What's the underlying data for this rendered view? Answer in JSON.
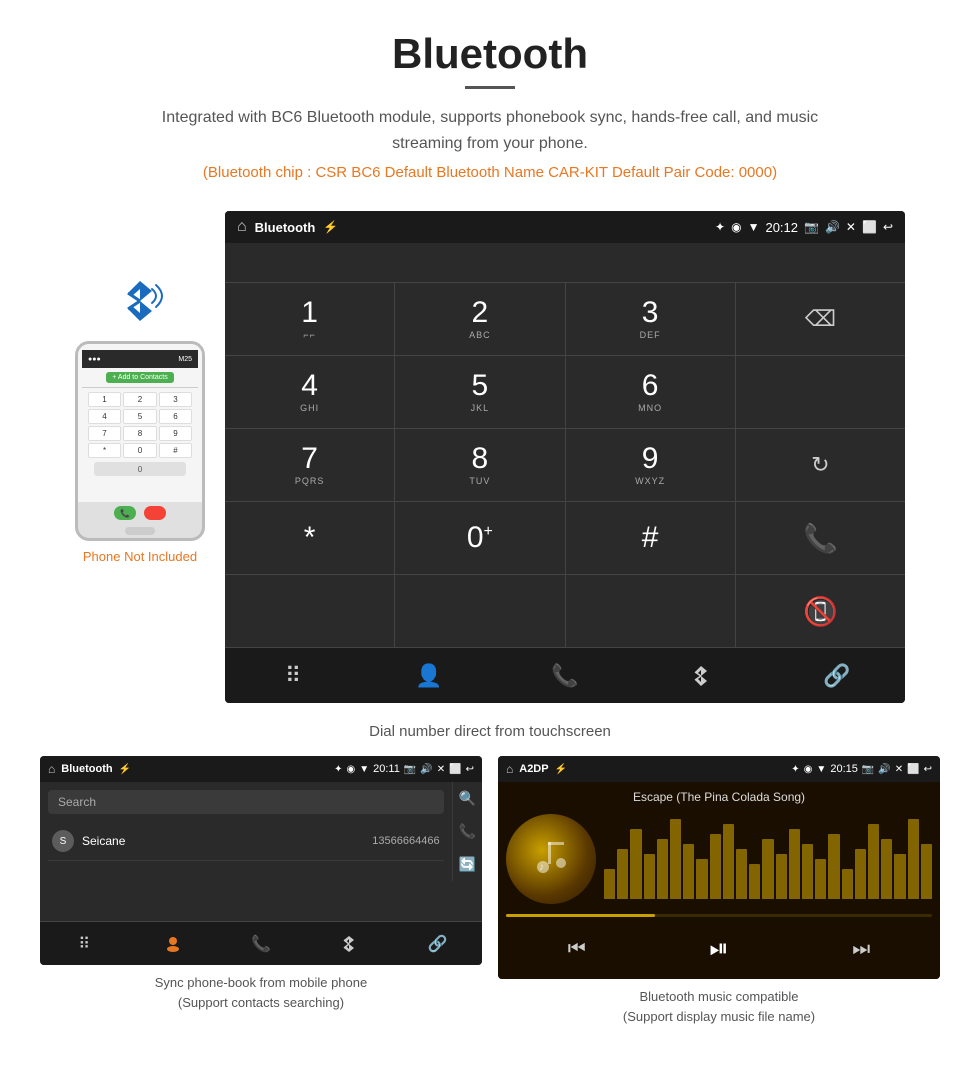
{
  "header": {
    "title": "Bluetooth",
    "description": "Integrated with BC6 Bluetooth module, supports phonebook sync, hands-free call, and music streaming from your phone.",
    "specs": "(Bluetooth chip : CSR BC6    Default Bluetooth Name CAR-KIT    Default Pair Code: 0000)"
  },
  "dial_screen": {
    "status_bar": {
      "app_name": "Bluetooth",
      "time": "20:12",
      "usb_icon": "⚡",
      "bt_icon": "✦",
      "location_icon": "◉",
      "signal_icon": "▼",
      "camera_icon": "⬛",
      "volume_icon": "🔊",
      "close_icon": "✕",
      "window_icon": "⬜",
      "back_icon": "↩"
    },
    "keys": [
      {
        "main": "1",
        "sub": "⌐⌐"
      },
      {
        "main": "2",
        "sub": "ABC"
      },
      {
        "main": "3",
        "sub": "DEF"
      },
      {
        "main": "",
        "sub": "",
        "special": "delete"
      },
      {
        "main": "4",
        "sub": "GHI"
      },
      {
        "main": "5",
        "sub": "JKL"
      },
      {
        "main": "6",
        "sub": "MNO"
      },
      {
        "main": "",
        "sub": "",
        "special": "empty"
      },
      {
        "main": "7",
        "sub": "PQRS"
      },
      {
        "main": "8",
        "sub": "TUV"
      },
      {
        "main": "9",
        "sub": "WXYZ"
      },
      {
        "main": "",
        "sub": "",
        "special": "refresh"
      },
      {
        "main": "*",
        "sub": ""
      },
      {
        "main": "0",
        "sub": "+"
      },
      {
        "main": "#",
        "sub": ""
      },
      {
        "main": "",
        "sub": "",
        "special": "call-green"
      },
      {
        "main": "",
        "sub": "",
        "special": "empty"
      },
      {
        "main": "",
        "sub": "",
        "special": "empty"
      },
      {
        "main": "",
        "sub": "",
        "special": "empty"
      },
      {
        "main": "",
        "sub": "",
        "special": "call-red"
      }
    ],
    "bottom_nav": [
      "⠿",
      "👤",
      "📞",
      "✦",
      "🔗"
    ],
    "caption": "Dial number direct from touchscreen"
  },
  "phonebook_screen": {
    "status_bar": {
      "app_name": "Bluetooth",
      "time": "20:11"
    },
    "search_placeholder": "Search",
    "contacts": [
      {
        "initial": "S",
        "name": "Seicane",
        "number": "13566664466"
      }
    ],
    "side_icons": [
      "🔍",
      "📞",
      "🔄"
    ],
    "bottom_nav": [
      "⠿",
      "👤",
      "📞",
      "✦",
      "🔗"
    ],
    "caption": "Sync phone-book from mobile phone\n(Support contacts searching)"
  },
  "music_screen": {
    "status_bar": {
      "app_name": "A2DP",
      "time": "20:15"
    },
    "song_title": "Escape (The Pina Colada Song)",
    "controls": [
      "⏮",
      "⏯",
      "⏭"
    ],
    "eq_heights": [
      30,
      50,
      70,
      45,
      60,
      80,
      55,
      40,
      65,
      75,
      50,
      35,
      60,
      45,
      70,
      55,
      40,
      65,
      30,
      50,
      75,
      60,
      45,
      80,
      55
    ],
    "caption": "Bluetooth music compatible\n(Support display music file name)"
  },
  "phone_illustration": {
    "not_included_label": "Phone Not Included",
    "add_contacts_label": "+ Add to Contacts",
    "keys": [
      "1",
      "2",
      "3",
      "4",
      "5",
      "6",
      "7",
      "8",
      "9",
      "*",
      "0",
      "#"
    ]
  }
}
